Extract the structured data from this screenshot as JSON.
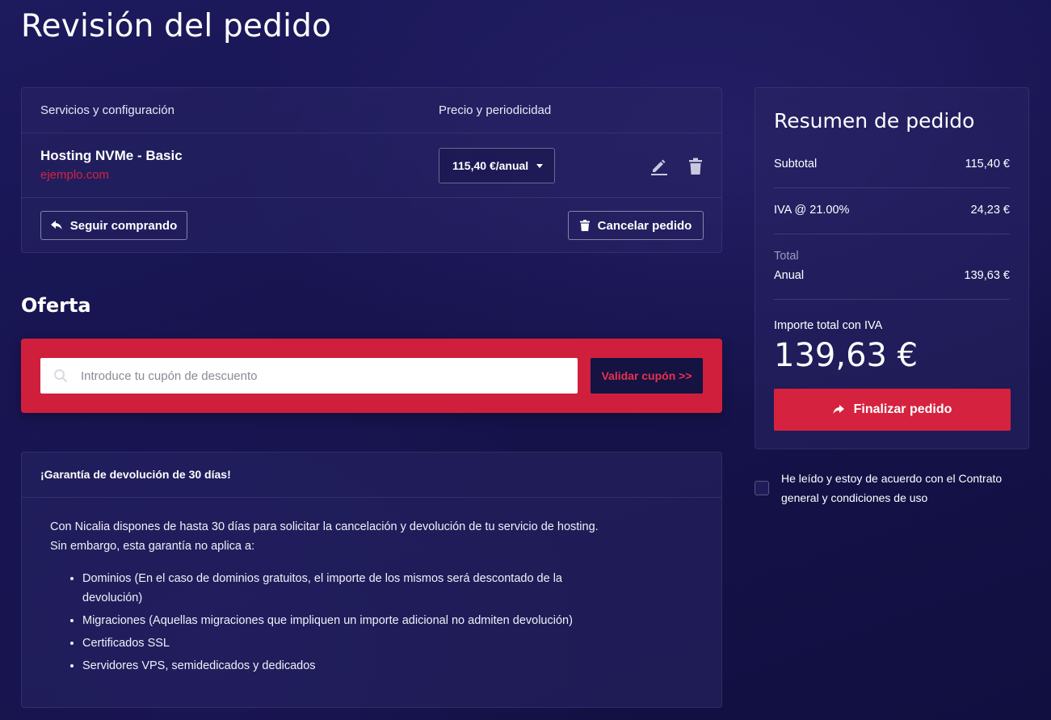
{
  "page": {
    "title": "Revisión del pedido"
  },
  "order": {
    "col_services": "Servicios y configuración",
    "col_price": "Precio y periodicidad",
    "item": {
      "name": "Hosting NVMe - Basic",
      "domain": "ejemplo.com",
      "period": "115,40 €/anual"
    },
    "continue_label": "Seguir comprando",
    "cancel_label": "Cancelar pedido"
  },
  "offer": {
    "title": "Oferta",
    "coupon_placeholder": "Introduce tu cupón de descuento",
    "validate_label": "Validar cupón >>"
  },
  "guarantee": {
    "title": "¡Garantía de devolución de 30 días!",
    "line1": "Con Nicalia dispones de hasta 30 días para solicitar la cancelación y devolución de tu servicio de hosting.",
    "line2": "Sin embargo, esta garantía no aplica a:",
    "items": [
      "Dominios (En el caso de dominios gratuitos, el importe de los mismos será descontado de la devolución)",
      "Migraciones (Aquellas migraciones que impliquen un importe adicional no admiten devolución)",
      "Certificados SSL",
      "Servidores VPS, semidedicados y dedicados"
    ]
  },
  "summary": {
    "title": "Resumen de pedido",
    "subtotal_label": "Subtotal",
    "subtotal_value": "115,40 €",
    "vat_label": "IVA @ 21.00%",
    "vat_value": "24,23 €",
    "total_label": "Total",
    "annual_label": "Anual",
    "annual_value": "139,63 €",
    "import_label": "Importe total con IVA",
    "import_amount": "139,63 €",
    "finish_label": "Finalizar pedido"
  },
  "terms": {
    "text": "He leído y estoy de acuerdo con el Contrato general y condiciones de uso"
  },
  "colors": {
    "accent": "#d5233f",
    "background": "#16134d",
    "dark_button": "#141342"
  }
}
